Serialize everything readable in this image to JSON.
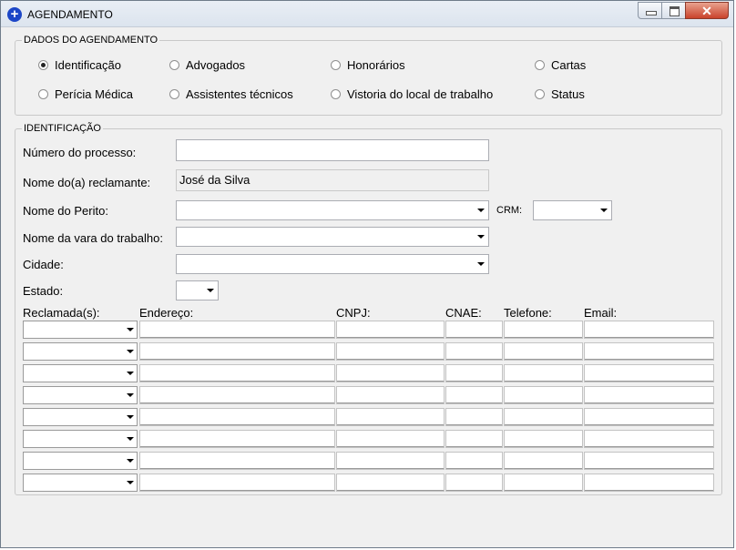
{
  "window": {
    "title": "AGENDAMENTO",
    "icon": "plus-circle-icon",
    "close_glyph": "✕"
  },
  "schedule_group": {
    "title": "DADOS DO AGENDAMENTO",
    "options": [
      "Identificação",
      "Advogados",
      "Honorários",
      "Cartas",
      "Perícia Médica",
      "Assistentes técnicos",
      "Vistoria do local de trabalho",
      "Status"
    ],
    "selected": "Identificação"
  },
  "identification": {
    "title": "IDENTIFICAÇÃO",
    "process_number_label": "Número do processo:",
    "process_number_value": "",
    "claimant_label": "Nome do(a) reclamante:",
    "claimant_value": "José da Silva",
    "expert_label": "Nome do Perito:",
    "expert_value": "",
    "crm_label": "CRM:",
    "crm_value": "",
    "court_label": "Nome da vara do trabalho:",
    "court_value": "",
    "city_label": "Cidade:",
    "city_value": "",
    "state_label": "Estado:",
    "state_value": ""
  },
  "defendants_table": {
    "columns": [
      "Reclamada(s):",
      "Endereço:",
      "CNPJ:",
      "CNAE:",
      "Telefone:",
      "Email:"
    ],
    "rows": [
      [
        "",
        "",
        "",
        "",
        "",
        ""
      ],
      [
        "",
        "",
        "",
        "",
        "",
        ""
      ],
      [
        "",
        "",
        "",
        "",
        "",
        ""
      ],
      [
        "",
        "",
        "",
        "",
        "",
        ""
      ],
      [
        "",
        "",
        "",
        "",
        "",
        ""
      ],
      [
        "",
        "",
        "",
        "",
        "",
        ""
      ],
      [
        "",
        "",
        "",
        "",
        "",
        ""
      ],
      [
        "",
        "",
        "",
        "",
        "",
        ""
      ]
    ]
  }
}
